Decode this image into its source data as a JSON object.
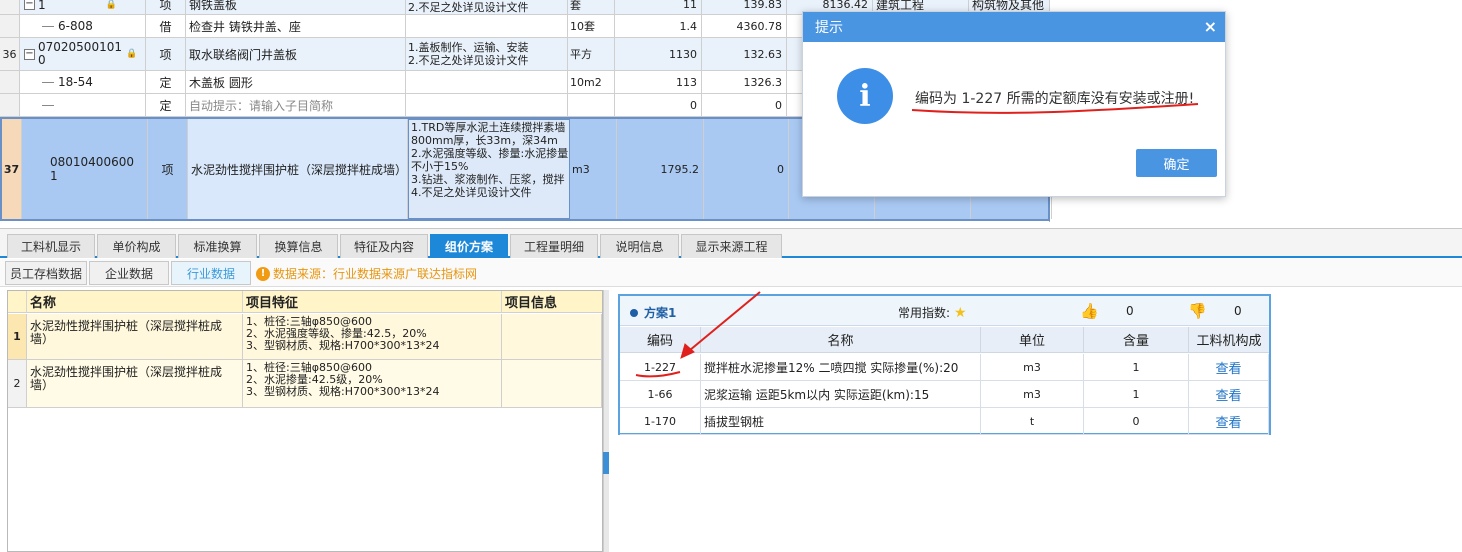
{
  "top_grid": {
    "rows": [
      {
        "idx": "",
        "code": "1",
        "cat": "项",
        "name": "钢铁盖板",
        "feature": "2.不足之处详见设计文件",
        "unit": "套",
        "qty": "11",
        "price": "139.83",
        "total": "8136.42",
        "major": "建筑工程",
        "type": "构筑物及其他"
      },
      {
        "idx": "",
        "code": "6-808",
        "cat": "借",
        "name": "检查井 铸铁井盖、座",
        "feature": "",
        "unit": "10套",
        "qty": "1.4",
        "price": "4360.78",
        "total": "",
        "major": "",
        "type": ""
      },
      {
        "idx": "36",
        "code_l1": "07020500101",
        "code_l2": "0",
        "cat": "项",
        "name": "取水联络阀门井盖板",
        "feature": "1.盖板制作、运输、安装\n2.不足之处详见设计文件",
        "unit": "平方",
        "qty": "1130",
        "price": "132.63",
        "total": "",
        "major": "",
        "type": ""
      },
      {
        "idx": "",
        "code": "18-54",
        "cat": "定",
        "name": "木盖板 圆形",
        "feature": "",
        "unit": "10m2",
        "qty": "113",
        "price": "1326.3",
        "total": "",
        "major": "",
        "type": ""
      },
      {
        "idx": "",
        "code": "",
        "cat": "定",
        "name": "自动提示：请输入子目简称",
        "feature": "",
        "unit": "",
        "qty": "0",
        "price": "0",
        "total": "",
        "major": "",
        "type": ""
      },
      {
        "idx": "37",
        "code_l1": "08010400600",
        "code_l2": "1",
        "cat": "项",
        "name": "水泥劲性搅拌围护桩（深层搅拌桩成墙）",
        "feature": "1.TRD等厚水泥土连续搅拌素墙800mm厚，长33m，深34m\n2.水泥强度等级、掺量:水泥掺量不小于15%\n3.钻进、浆液制作、压浆，搅拌\n4.不足之处详见设计文件",
        "unit": "m3",
        "qty": "1795.2",
        "price": "0",
        "total": "",
        "major": "",
        "type": ""
      }
    ]
  },
  "tabs": [
    "工料机显示",
    "单价构成",
    "标准换算",
    "换算信息",
    "特征及内容",
    "组价方案",
    "工程量明细",
    "说明信息",
    "显示来源工程"
  ],
  "active_tab": "组价方案",
  "subtabs": [
    "员工存档数据",
    "企业数据",
    "行业数据"
  ],
  "data_source": "数据来源：行业数据来源广联达指标网",
  "left_table": {
    "headers": [
      "名称",
      "项目特征",
      "项目信息"
    ],
    "rows": [
      {
        "idx": "1",
        "name": "水泥劲性搅拌围护桩（深层搅拌桩成墙）",
        "feature": "1、桩径:三轴φ850@600\n2、水泥强度等级、掺量:42.5，20%\n3、型钢材质、规格:H700*300*13*24"
      },
      {
        "idx": "2",
        "name": "水泥劲性搅拌围护桩（深层搅拌桩成墙）",
        "feature": "1、桩径:三轴φ850@600\n2、水泥掺量:42.5级，20%\n3、型钢材质、规格:H700*300*13*24"
      }
    ]
  },
  "plan": {
    "title": "方案1",
    "common_index_label": "常用指数:",
    "likes": "0",
    "dislikes": "0",
    "headers": [
      "编码",
      "名称",
      "单位",
      "含量",
      "工料机构成"
    ],
    "rows": [
      {
        "code": "1-227",
        "name": "搅拌桩水泥掺量12% 二喷四搅  实际掺量(%):20",
        "unit": "m3",
        "qty": "1",
        "view": "查看"
      },
      {
        "code": "1-66",
        "name": "泥浆运输 运距5km以内  实际运距(km):15",
        "unit": "m3",
        "qty": "1",
        "view": "查看"
      },
      {
        "code": "1-170",
        "name": "插拔型钢桩",
        "unit": "t",
        "qty": "0",
        "view": "查看"
      }
    ]
  },
  "dialog": {
    "title": "提示",
    "close": "×",
    "icon": "i",
    "message": "编码为 1-227 所需的定额库没有安装或注册!",
    "ok": "确定"
  },
  "colors": {
    "accent": "#1e88d8",
    "selected_row": "#a9c9f3",
    "annotation": "#e0201c"
  }
}
